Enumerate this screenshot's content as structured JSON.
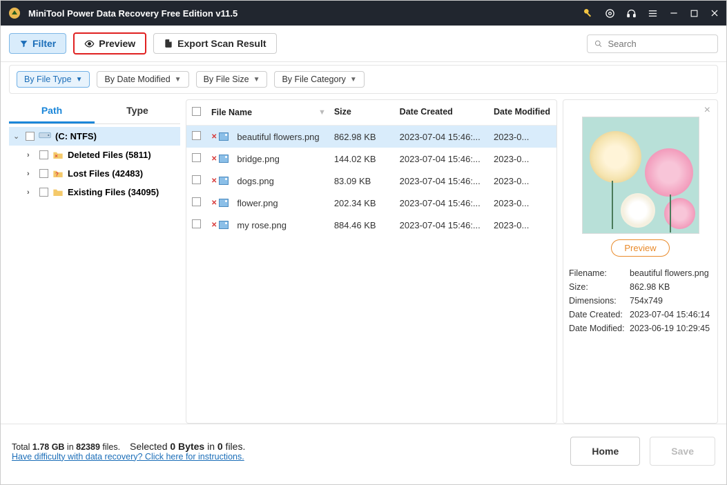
{
  "titlebar": {
    "app_title": "MiniTool Power Data Recovery Free Edition v11.5"
  },
  "toolbar": {
    "filter_label": "Filter",
    "preview_label": "Preview",
    "export_label": "Export Scan Result",
    "search_placeholder": "Search"
  },
  "filterbar": {
    "by_file_type": "By File Type",
    "by_date_modified": "By Date Modified",
    "by_file_size": "By File Size",
    "by_file_category": "By File Category"
  },
  "sidebar": {
    "tab_path": "Path",
    "tab_type": "Type",
    "root_label": "(C: NTFS)",
    "items": [
      {
        "label": "Deleted Files (5811)"
      },
      {
        "label": "Lost Files (42483)"
      },
      {
        "label": "Existing Files (34095)"
      }
    ]
  },
  "columns": {
    "name": "File Name",
    "size": "Size",
    "date_created": "Date Created",
    "date_modified": "Date Modified"
  },
  "files": [
    {
      "name": "beautiful flowers.png",
      "size": "862.98 KB",
      "dc": "2023-07-04 15:46:...",
      "dm": "2023-0...",
      "selected": true
    },
    {
      "name": "bridge.png",
      "size": "144.02 KB",
      "dc": "2023-07-04 15:46:...",
      "dm": "2023-0..."
    },
    {
      "name": "dogs.png",
      "size": "83.09 KB",
      "dc": "2023-07-04 15:46:...",
      "dm": "2023-0..."
    },
    {
      "name": "flower.png",
      "size": "202.34 KB",
      "dc": "2023-07-04 15:46:...",
      "dm": "2023-0..."
    },
    {
      "name": "my rose.png",
      "size": "884.46 KB",
      "dc": "2023-07-04 15:46:...",
      "dm": "2023-0..."
    }
  ],
  "preview": {
    "button_label": "Preview",
    "fields": {
      "filename_k": "Filename:",
      "filename_v": "beautiful flowers.png",
      "size_k": "Size:",
      "size_v": "862.98 KB",
      "dim_k": "Dimensions:",
      "dim_v": "754x749",
      "dc_k": "Date Created:",
      "dc_v": "2023-07-04 15:46:14",
      "dm_k": "Date Modified:",
      "dm_v": "2023-06-19 10:29:45"
    }
  },
  "footer": {
    "total_prefix": "Total ",
    "total_size": "1.78 GB",
    "total_mid": " in ",
    "total_count": "82389",
    "total_suffix": " files.",
    "selected_prefix": "Selected ",
    "selected_bytes": "0 Bytes",
    "selected_mid": " in ",
    "selected_count": "0",
    "selected_suffix": " files.",
    "help_link": "Have difficulty with data recovery? Click here for instructions.",
    "home_label": "Home",
    "save_label": "Save"
  }
}
